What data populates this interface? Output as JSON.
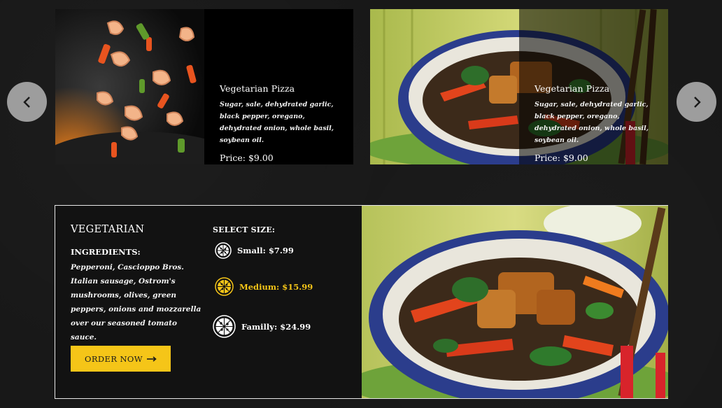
{
  "carousel": {
    "cards": [
      {
        "title": "Vegetarian Pizza",
        "description": "Sugar, sale, dehydrated garlic, black pepper, oregano, dehydrated onion, whole basil, soybean oil.",
        "price": "Price: $9.00",
        "image": "shrimp-wok-photo"
      },
      {
        "title": "Vegetarian Pizza",
        "description": "Sugar, sale, dehydrated garlic, black pepper, oregano, dehydrated onion, whole basil, soybean oil.",
        "price": "Price: $9.00",
        "image": "tofu-vegetable-bowl-photo"
      }
    ],
    "prev_icon": "chevron-left-icon",
    "next_icon": "chevron-right-icon"
  },
  "detail": {
    "name": "VEGETARIAN",
    "ingredients_label": "INGREDIENTS:",
    "ingredients_text": "Pepperoni, Cascioppo Bros. Italian sausage, Ostrom's mushrooms, olives, green peppers, onions and mozzarella over our seasoned tomato sauce.",
    "order_label": "ORDER NOW",
    "order_icon": "arrow-right-icon",
    "size_label": "SELECT SIZE:",
    "sizes": [
      {
        "label": "Small: $7.99",
        "icon": "pizza-small-icon",
        "selected": false
      },
      {
        "label": "Medium: $15.99",
        "icon": "pizza-medium-icon",
        "selected": true
      },
      {
        "label": "Familly: $24.99",
        "icon": "pizza-large-icon",
        "selected": false
      }
    ],
    "image": "tofu-vegetable-bowl-photo"
  },
  "colors": {
    "background": "#181818",
    "accent_yellow": "#f5c518",
    "nav_button": "#9d9d9d",
    "panel_border": "#e7e7e7"
  }
}
